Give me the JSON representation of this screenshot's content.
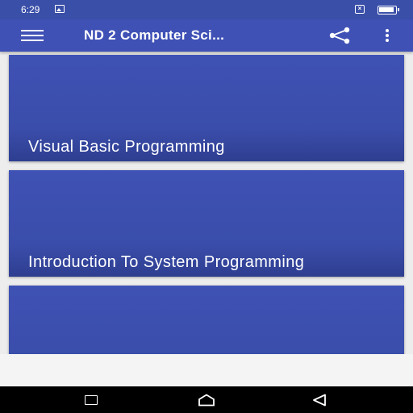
{
  "status_bar": {
    "time": "6:29",
    "left_icons": [
      "image-icon"
    ],
    "right_icons": [
      "x-box-icon",
      "battery-icon"
    ]
  },
  "app_bar": {
    "title": "ND 2 Computer Sci...",
    "icons": [
      "menu-icon",
      "share-icon",
      "more-vert-icon"
    ],
    "color": "#3f51b5"
  },
  "cards": [
    {
      "title": "Visual Basic Programming"
    },
    {
      "title": "Introduction To System Programming"
    },
    {
      "title": ""
    }
  ],
  "nav_bar": {
    "icons": [
      "recent-apps-icon",
      "home-icon",
      "back-icon"
    ]
  }
}
